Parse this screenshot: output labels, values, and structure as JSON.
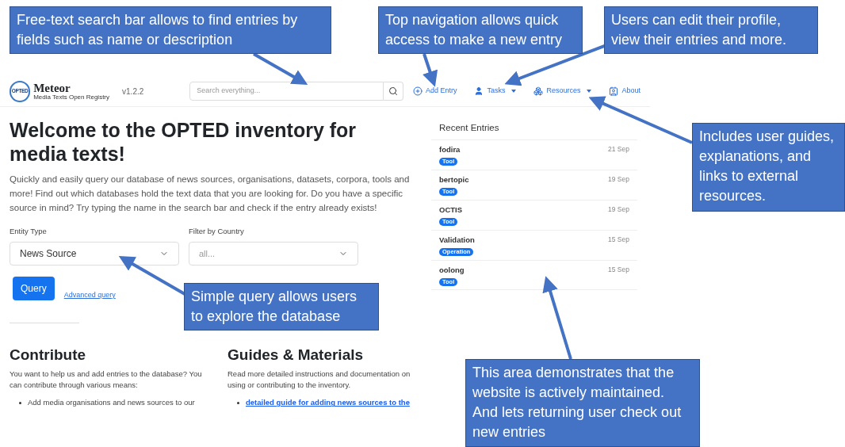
{
  "header": {
    "logo_badge": "OPTED",
    "logo_title": "Meteor",
    "logo_subtitle": "Media Texts Open Registry",
    "version": "v1.2.2",
    "search": {
      "placeholder": "Search everything..."
    },
    "nav": [
      {
        "label": "Add Entry",
        "dropdown": false
      },
      {
        "label": "Tasks",
        "dropdown": true
      },
      {
        "label": "Resources",
        "dropdown": true
      },
      {
        "label": "About",
        "dropdown": false
      }
    ]
  },
  "hero": {
    "title": "Welcome to the OPTED inventory for media texts!",
    "text": "Quickly and easily query our database of news sources, organisations, datasets, corpora, tools and more! Find out which databases hold the text data that you are looking for. Do you have a specific source in mind? Try typing the name in the search bar and check if the entry already exists!"
  },
  "query_form": {
    "fields": [
      {
        "label": "Entity Type",
        "value": "News Source"
      },
      {
        "label": "Filter by Country",
        "placeholder": "all..."
      }
    ],
    "button": "Query",
    "link": "Advanced query"
  },
  "sections": [
    {
      "title": "Contribute",
      "text": "You want to help us and add entries to the database? You can contribute through various means:",
      "bullets": [
        {
          "kind": "plain",
          "text": "Add media organisations and news sources to our"
        }
      ]
    },
    {
      "title": "Guides & Materials",
      "text": "Read more detailed instructions and documentation on using or contributing to the inventory.",
      "bullets": [
        {
          "kind": "link",
          "text": "detailed guide for adding news sources to the"
        }
      ]
    }
  ],
  "recent_entries": {
    "title": "Recent Entries",
    "entries": [
      {
        "name": "fodira",
        "tag": "Tool",
        "date": "21 Sep"
      },
      {
        "name": "bertopic",
        "tag": "Tool",
        "date": "19 Sep"
      },
      {
        "name": "OCTIS",
        "tag": "Tool",
        "date": "19 Sep"
      },
      {
        "name": "Validation",
        "tag": "Operation",
        "date": "15 Sep"
      },
      {
        "name": "oolong",
        "tag": "Tool",
        "date": "15 Sep"
      }
    ]
  },
  "callouts": [
    {
      "text": "Free-text search bar allows to find entries by fields such as name or description"
    },
    {
      "text": "Top navigation allows quick access to make a new entry"
    },
    {
      "text": "Users can edit their profile, view their entries and more."
    },
    {
      "text": "Includes user guides, explanations, and links to external resources."
    },
    {
      "text": "Simple query allows users to explore the database"
    },
    {
      "text": "This area demonstrates that the website is actively maintained. And lets returning user check out new entries"
    }
  ]
}
